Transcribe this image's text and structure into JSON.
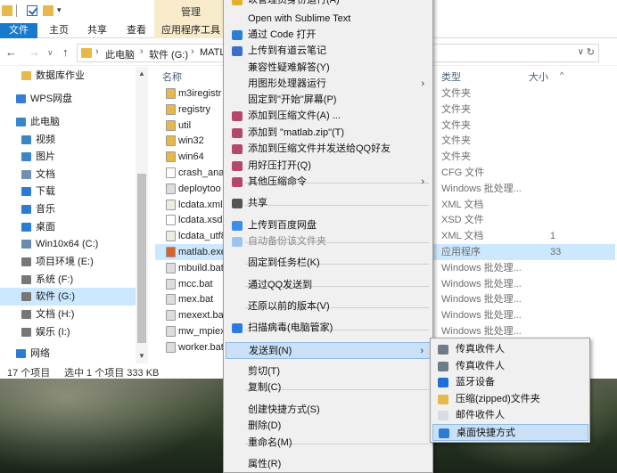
{
  "colors": {
    "accent": "#1979ca",
    "selection": "#cce8ff",
    "menu_bg": "#f0f0f0",
    "menu_highlight": "#c9e0f7",
    "folder": "#e8b84a",
    "apptools_tab": "#f7ebcb"
  },
  "titlebar": {
    "quick_access_dropdown": "▾",
    "manage_tab": "管理"
  },
  "ribbon": {
    "file": "文件",
    "home": "主页",
    "share": "共享",
    "view": "查看",
    "app_tools": "应用程序工具"
  },
  "nav": {
    "back": "←",
    "forward": "→",
    "history": "∨",
    "up": "↑",
    "breadcrumb": [
      "此电脑",
      "软件 (G:)",
      "MATL"
    ],
    "dropdown": "∨",
    "refresh": "↻"
  },
  "sidebar": {
    "items": [
      {
        "label": "数据库作业",
        "icon": "folder-icon",
        "color": "#e8b84a"
      },
      {
        "label": "WPS网盘",
        "icon": "cloud-icon",
        "color": "#3a7bd5"
      },
      {
        "label": "此电脑",
        "icon": "computer-icon",
        "color": "#3a86c8"
      },
      {
        "label": "视频",
        "icon": "video-icon",
        "color": "#3a86c8"
      },
      {
        "label": "图片",
        "icon": "picture-icon",
        "color": "#3a86c8"
      },
      {
        "label": "文档",
        "icon": "document-icon",
        "color": "#6f8fb3"
      },
      {
        "label": "下载",
        "icon": "download-icon",
        "color": "#2b7cd3"
      },
      {
        "label": "音乐",
        "icon": "music-icon",
        "color": "#2b7cd3"
      },
      {
        "label": "桌面",
        "icon": "desktop-icon",
        "color": "#2b7cd3"
      },
      {
        "label": "Win10x64 (C:)",
        "icon": "system-drive-icon",
        "color": "#6b8ab0"
      },
      {
        "label": "项目环境 (E:)",
        "icon": "drive-icon",
        "color": "#777777"
      },
      {
        "label": "系统 (F:)",
        "icon": "drive-icon",
        "color": "#777777"
      },
      {
        "label": "软件 (G:)",
        "icon": "drive-icon",
        "color": "#777777"
      },
      {
        "label": "文档 (H:)",
        "icon": "drive-icon",
        "color": "#777777"
      },
      {
        "label": "娱乐 (I:)",
        "icon": "drive-icon",
        "color": "#777777"
      },
      {
        "label": "网络",
        "icon": "network-icon",
        "color": "#2b7cd3"
      }
    ],
    "scroll_up": "▲",
    "scroll_down": "▼"
  },
  "filelist": {
    "col_name": "名称",
    "col_type": "类型",
    "col_size": "大小",
    "col_sort_up": "^",
    "rows": [
      {
        "name": "m3iregistr",
        "type": "文件夹",
        "size": "",
        "icon": "folder-icon",
        "color": "#e8b84a"
      },
      {
        "name": "registry",
        "type": "文件夹",
        "size": "",
        "icon": "folder-icon",
        "color": "#e8b84a"
      },
      {
        "name": "util",
        "type": "文件夹",
        "size": "",
        "icon": "folder-icon",
        "color": "#e8b84a"
      },
      {
        "name": "win32",
        "type": "文件夹",
        "size": "",
        "icon": "folder-icon",
        "color": "#e8b84a"
      },
      {
        "name": "win64",
        "type": "文件夹",
        "size": "",
        "icon": "folder-icon",
        "color": "#e8b84a"
      },
      {
        "name": "crash_analy",
        "type": "CFG 文件",
        "size": "",
        "icon": "file-icon",
        "color": "#ffffff"
      },
      {
        "name": "deploytoo",
        "type": "Windows 批处理...",
        "size": "",
        "icon": "gear-file-icon",
        "color": "#dddddd"
      },
      {
        "name": "lcdata.xml",
        "type": "XML 文档",
        "size": "",
        "icon": "xml-file-icon",
        "color": "#e9f0e0"
      },
      {
        "name": "lcdata.xsd",
        "type": "XSD 文件",
        "size": "",
        "icon": "file-icon",
        "color": "#ffffff"
      },
      {
        "name": "lcdata_utf8",
        "type": "XML 文档",
        "size": "1",
        "icon": "xml-file-icon",
        "color": "#e9f0e0"
      },
      {
        "name": "matlab.exe",
        "type": "应用程序",
        "size": "33",
        "icon": "matlab-icon",
        "color": "#d9622b"
      },
      {
        "name": "mbuild.bat",
        "type": "Windows 批处理...",
        "size": "",
        "icon": "gear-file-icon",
        "color": "#dddddd"
      },
      {
        "name": "mcc.bat",
        "type": "Windows 批处理...",
        "size": "",
        "icon": "gear-file-icon",
        "color": "#dddddd"
      },
      {
        "name": "mex.bat",
        "type": "Windows 批处理...",
        "size": "",
        "icon": "gear-file-icon",
        "color": "#dddddd"
      },
      {
        "name": "mexext.bat",
        "type": "Windows 批处理...",
        "size": "",
        "icon": "gear-file-icon",
        "color": "#dddddd"
      },
      {
        "name": "mw_mpiex",
        "type": "Windows 批处理...",
        "size": "",
        "icon": "gear-file-icon",
        "color": "#dddddd"
      },
      {
        "name": "worker.bat",
        "type": "",
        "size": "",
        "icon": "gear-file-icon",
        "color": "#dddddd"
      }
    ]
  },
  "statusbar": {
    "count": "17 个项目",
    "selection": "选中 1 个项目  333 KB"
  },
  "context_menu": {
    "items": [
      {
        "label": "以管理员身份运行(A)",
        "icon": "shield-icon",
        "color": "#e5b12c",
        "arrow": ""
      },
      {
        "label": "Open with Sublime Text",
        "icon": "",
        "color": "",
        "arrow": ""
      },
      {
        "label": "通过 Code 打开",
        "icon": "vscode-icon",
        "color": "#2a7fd4",
        "arrow": ""
      },
      {
        "label": "上传到有道云笔记",
        "icon": "note-icon",
        "color": "#3b6fc9",
        "arrow": ""
      },
      {
        "label": "兼容性疑难解答(Y)",
        "icon": "",
        "color": "",
        "arrow": ""
      },
      {
        "label": "用图形处理器运行",
        "icon": "",
        "color": "",
        "arrow": "›"
      },
      {
        "label": "固定到\"开始\"屏幕(P)",
        "icon": "",
        "color": "",
        "arrow": ""
      },
      {
        "label": "添加到压缩文件(A) ...",
        "icon": "archive-icon",
        "color": "#b5476d",
        "arrow": ""
      },
      {
        "label": "添加到 \"matlab.zip\"(T)",
        "icon": "archive-icon",
        "color": "#b5476d",
        "arrow": ""
      },
      {
        "label": "添加到压缩文件并发送给QQ好友",
        "icon": "archive-icon",
        "color": "#b5476d",
        "arrow": ""
      },
      {
        "label": "用好压打开(Q)",
        "icon": "archive-icon",
        "color": "#b5476d",
        "arrow": ""
      },
      {
        "label": "其他压缩命令",
        "icon": "archive-icon",
        "color": "#b5476d",
        "arrow": "›"
      },
      {
        "label": "共享",
        "icon": "share-icon",
        "color": "#555555",
        "arrow": ""
      },
      {
        "label": "上传到百度网盘",
        "icon": "baidu-cloud-icon",
        "color": "#3b8fe6",
        "arrow": ""
      },
      {
        "label": "自动备份该文件夹",
        "icon": "baidu-cloud-icon",
        "color": "#9cc4f0",
        "arrow": ""
      },
      {
        "label": "固定到任务栏(K)",
        "icon": "",
        "color": "",
        "arrow": ""
      },
      {
        "label": "通过QQ发送到",
        "icon": "",
        "color": "",
        "arrow": ""
      },
      {
        "label": "还原以前的版本(V)",
        "icon": "",
        "color": "",
        "arrow": ""
      },
      {
        "label": "扫描病毒(电脑管家)",
        "icon": "antivirus-icon",
        "color": "#2c7be5",
        "arrow": ""
      },
      {
        "label": "发送到(N)",
        "icon": "",
        "color": "",
        "arrow": "›"
      },
      {
        "label": "剪切(T)",
        "icon": "",
        "color": "",
        "arrow": ""
      },
      {
        "label": "复制(C)",
        "icon": "",
        "color": "",
        "arrow": ""
      },
      {
        "label": "创建快捷方式(S)",
        "icon": "",
        "color": "",
        "arrow": ""
      },
      {
        "label": "删除(D)",
        "icon": "",
        "color": "",
        "arrow": ""
      },
      {
        "label": "重命名(M)",
        "icon": "",
        "color": "",
        "arrow": ""
      },
      {
        "label": "属性(R)",
        "icon": "",
        "color": "",
        "arrow": ""
      }
    ]
  },
  "send_to_menu": {
    "items": [
      {
        "label": "传真收件人",
        "icon": "fax-icon",
        "color": "#6e7b88"
      },
      {
        "label": "传真收件人",
        "icon": "fax-icon",
        "color": "#6e7b88"
      },
      {
        "label": "蓝牙设备",
        "icon": "bluetooth-icon",
        "color": "#1e6fd9"
      },
      {
        "label": "压缩(zipped)文件夹",
        "icon": "zip-folder-icon",
        "color": "#e8b84a"
      },
      {
        "label": "邮件收件人",
        "icon": "mail-icon",
        "color": "#d8dde3"
      },
      {
        "label": "桌面快捷方式",
        "icon": "desktop-shortcut-icon",
        "color": "#2b7cd3"
      }
    ]
  }
}
